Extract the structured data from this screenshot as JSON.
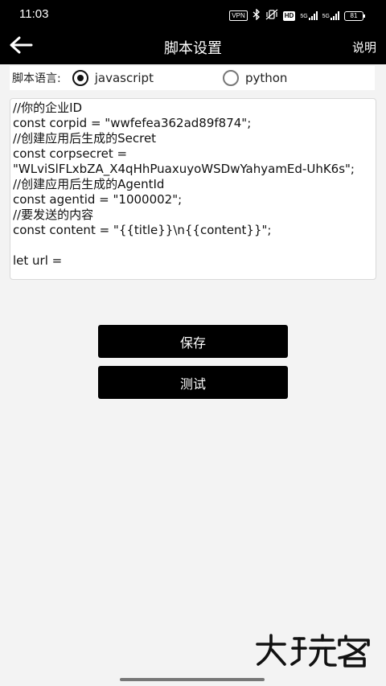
{
  "status_bar": {
    "time": "11:03",
    "vpn": "VPN",
    "hd": "HD",
    "sim1": "5G",
    "sim2": "5G",
    "battery": "81"
  },
  "app_bar": {
    "title": "脚本设置",
    "help_label": "说明",
    "back_icon": "back-arrow-icon"
  },
  "language": {
    "label": "脚本语言:",
    "options": [
      {
        "label": "javascript",
        "selected": true
      },
      {
        "label": "python",
        "selected": false
      }
    ]
  },
  "editor": {
    "content": "//你的企业ID\nconst corpid = \"wwfefea362ad89f874\";\n//创建应用后生成的Secret\nconst corpsecret =\n\"WLviSlFLxbZA_X4qHhPuaxuyoWSDwYahyamEd-UhK6s\";\n//创建应用后生成的AgentId\nconst agentid = \"1000002\";\n//要发送的内容\nconst content = \"{{title}}\\n{{content}}\";\n\nlet url ="
  },
  "buttons": {
    "save_label": "保存",
    "test_label": "测试"
  },
  "watermark": {
    "text": "大玩客"
  }
}
